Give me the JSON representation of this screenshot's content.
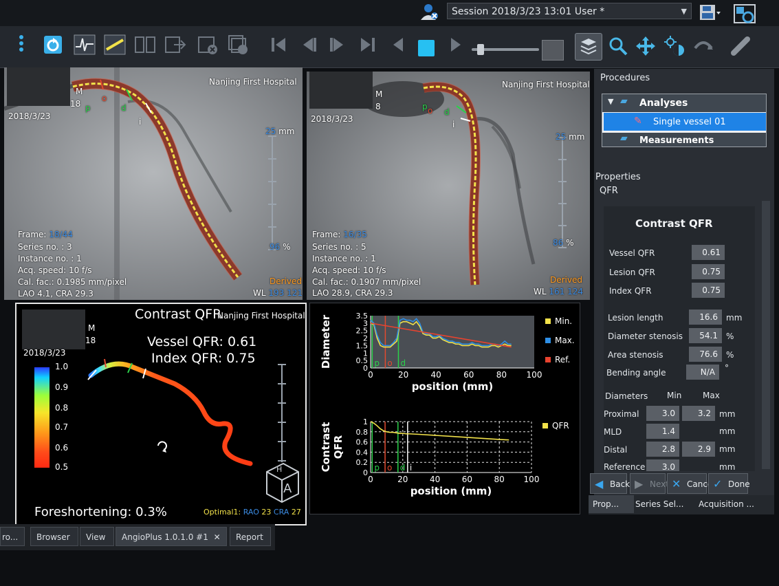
{
  "session": {
    "label": "Session 2018/3/23 13:01 User *"
  },
  "toolbar": {
    "items": [
      "menu-icon",
      "refresh-icon",
      "ecg-icon",
      "calibration-icon",
      "compare-icon",
      "export-icon",
      "delete-icon",
      "delete-all-icon",
      "first-frame-icon",
      "prev-frame-icon",
      "next-frame-icon",
      "last-frame-icon",
      "play-back-icon",
      "stop-icon",
      "play-icon",
      "zoom-icon",
      "pan-icon",
      "brightness-contrast-icon",
      "rotate-icon",
      "vessel-tool-icon"
    ]
  },
  "view1": {
    "hospital": "Nanjing First Hospital",
    "date": "2018/3/23",
    "name_fragment": "M",
    "id_fragment": "18",
    "frame_label": "Frame:",
    "frame_value": "18/44",
    "series": "Series no. : 3",
    "instance": "Instance no. : 1",
    "acq": "Acq. speed: 10 f/s",
    "cal": "Cal. fac.: 0.1985 mm/pixel",
    "angle": "LAO 4.1, CRA 29.3",
    "scale_mm": "25",
    "scale_unit": "mm",
    "zoom": "96",
    "zoom_unit": "%",
    "derived": "Derived",
    "wl_label": "WL",
    "wl_value": "193 121",
    "markers": {
      "p": "p",
      "o": "o",
      "d": "d",
      "i": "i"
    }
  },
  "view2": {
    "hospital": "Nanjing First Hospital",
    "date": "2018/3/23",
    "name_fragment": "M",
    "id_fragment": "8",
    "frame_label": "Frame:",
    "frame_value": "16/35",
    "series": "Series no. : 5",
    "instance": "Instance no. : 1",
    "acq": "Acq. speed: 10 f/s",
    "cal": "Cal. fac.: 0.1907 mm/pixel",
    "angle": "LAO 28.9, CRA 29.3",
    "scale_mm": "25",
    "scale_unit": "mm",
    "zoom": "86",
    "zoom_unit": "%",
    "derived": "Derived",
    "wl_label": "WL",
    "wl_value": "161 124",
    "markers": {
      "p": "p",
      "o": "o",
      "d": "d",
      "i": "i"
    }
  },
  "render3d": {
    "title": "Contrast QFR",
    "hospital": "Nanjing First Hospital",
    "name_fragment": "M",
    "id_fragment": "18",
    "date": "2018/3/23",
    "vessel_qfr": "Vessel QFR: 0.61",
    "index_qfr": "Index QFR: 0.75",
    "colorbar_ticks": [
      "1.0",
      "0.9",
      "0.8",
      "0.7",
      "0.6",
      "0.5"
    ],
    "foreshortening": "Foreshortening: 0.3%",
    "optimal_label": "Optimal1:",
    "optimal_rao_label": "RAO",
    "optimal_rao": "23",
    "optimal_cra_label": "CRA",
    "optimal_cra": "27",
    "cube_top": "H",
    "cube_front": "A"
  },
  "plots": {
    "diameter": {
      "ylabel": "Diameter",
      "xlabel": "position (mm)",
      "legend": [
        "Min.",
        "Max.",
        "Ref."
      ],
      "marker_labels": [
        "p",
        "o",
        "d"
      ]
    },
    "qfr": {
      "ylabel": "Contrast QFR",
      "xlabel": "position (mm)",
      "legend": [
        "QFR"
      ],
      "marker_labels": [
        "p",
        "o",
        "d",
        "i"
      ]
    }
  },
  "chart_data": [
    {
      "type": "line",
      "title": "",
      "xlabel": "position (mm)",
      "ylabel": "Diameter",
      "xlim": [
        0,
        100
      ],
      "ylim": [
        0,
        3.5
      ],
      "xticks": [
        "0",
        "20",
        "40",
        "60",
        "80",
        "100"
      ],
      "yticks": [
        "0",
        "0.5",
        "1",
        "1.5",
        "2",
        "2.5",
        "3",
        "3.5"
      ],
      "legend_position": "right",
      "markers": [
        {
          "label": "p",
          "x": 1
        },
        {
          "label": "o",
          "x": 9
        },
        {
          "label": "d",
          "x": 17
        }
      ],
      "series": [
        {
          "name": "Min.",
          "color": "#f2e24a",
          "x": [
            0,
            2,
            4,
            6,
            8,
            10,
            12,
            14,
            16,
            18,
            20,
            22,
            24,
            26,
            28,
            30,
            32,
            34,
            36,
            38,
            40,
            42,
            44,
            46,
            48,
            50,
            52,
            54,
            56,
            58,
            60,
            62,
            64,
            66,
            68,
            70,
            72,
            74,
            76,
            78,
            80,
            82,
            84,
            86
          ],
          "y": [
            3.0,
            2.9,
            2.0,
            1.5,
            1.4,
            1.4,
            1.4,
            1.6,
            1.8,
            3.0,
            3.1,
            3.1,
            3.0,
            2.9,
            3.1,
            2.8,
            2.3,
            2.2,
            2.2,
            2.0,
            2.0,
            2.1,
            1.9,
            1.8,
            1.7,
            1.7,
            1.6,
            1.6,
            1.5,
            1.5,
            1.5,
            1.6,
            1.5,
            1.5,
            1.4,
            1.4,
            1.4,
            1.5,
            1.5,
            1.4,
            1.5,
            1.6,
            1.5,
            1.5
          ]
        },
        {
          "name": "Max.",
          "color": "#2e8fe6",
          "x": [
            0,
            2,
            4,
            6,
            8,
            10,
            12,
            14,
            16,
            18,
            20,
            22,
            24,
            26,
            28,
            30,
            32,
            34,
            36,
            38,
            40,
            42,
            44,
            46,
            48,
            50,
            52,
            54,
            56,
            58,
            60,
            62,
            64,
            66,
            68,
            70,
            72,
            74,
            76,
            78,
            80,
            82,
            84,
            86
          ],
          "y": [
            3.2,
            3.0,
            2.2,
            1.7,
            1.5,
            1.5,
            1.5,
            1.7,
            2.0,
            3.2,
            3.3,
            3.2,
            3.2,
            3.1,
            3.3,
            3.0,
            2.4,
            2.3,
            2.3,
            2.1,
            2.1,
            2.2,
            2.0,
            1.9,
            1.8,
            1.8,
            1.7,
            1.7,
            1.6,
            1.6,
            1.6,
            1.7,
            1.6,
            1.6,
            1.5,
            1.5,
            1.5,
            1.6,
            1.6,
            1.5,
            1.6,
            1.8,
            1.6,
            1.6
          ]
        },
        {
          "name": "Ref.",
          "color": "#e8432f",
          "x": [
            0,
            86
          ],
          "y": [
            3.0,
            1.4
          ]
        }
      ]
    },
    {
      "type": "line",
      "title": "",
      "xlabel": "position (mm)",
      "ylabel": "Contrast QFR",
      "xlim": [
        0,
        100
      ],
      "ylim": [
        0,
        1
      ],
      "xticks": [
        "0",
        "20",
        "40",
        "60",
        "80",
        "100"
      ],
      "yticks": [
        "0",
        "0.2",
        "0.4",
        "0.6",
        "0.8",
        "1"
      ],
      "legend_position": "right",
      "grid": true,
      "markers": [
        {
          "label": "p",
          "x": 1
        },
        {
          "label": "o",
          "x": 9
        },
        {
          "label": "d",
          "x": 17
        },
        {
          "label": "i",
          "x": 23
        }
      ],
      "series": [
        {
          "name": "QFR",
          "color": "#f2e24a",
          "x": [
            0,
            2,
            4,
            6,
            8,
            10,
            12,
            14,
            16,
            18,
            20,
            22,
            24,
            30,
            40,
            50,
            60,
            70,
            80,
            86
          ],
          "y": [
            1.0,
            0.97,
            0.92,
            0.86,
            0.82,
            0.8,
            0.79,
            0.79,
            0.78,
            0.77,
            0.77,
            0.76,
            0.76,
            0.75,
            0.73,
            0.71,
            0.69,
            0.67,
            0.65,
            0.64
          ]
        }
      ]
    }
  ],
  "sidebar": {
    "procedures_title": "Procedures",
    "tree": {
      "analyses": "Analyses",
      "single_vessel": "Single vessel 01",
      "measurements": "Measurements"
    },
    "properties_title": "Properties",
    "properties_sub": "QFR",
    "panel_title": "Contrast QFR",
    "rows_top": [
      {
        "label": "Vessel QFR",
        "value": "0.61"
      },
      {
        "label": "Lesion QFR",
        "value": "0.75"
      },
      {
        "label": "Index QFR",
        "value": "0.75"
      }
    ],
    "rows_mid": [
      {
        "label": "Lesion length",
        "value": "16.6",
        "unit": "mm"
      },
      {
        "label": "Diameter stenosis",
        "value": "54.1",
        "unit": "%"
      },
      {
        "label": "Area stenosis",
        "value": "76.6",
        "unit": "%"
      },
      {
        "label": "Bending angle",
        "value": "N/A",
        "unit": "°"
      }
    ],
    "diameters_header": {
      "label": "Diameters",
      "min": "Min",
      "max": "Max"
    },
    "diameters": [
      {
        "label": "Proximal",
        "min": "3.0",
        "max": "3.2",
        "unit": "mm"
      },
      {
        "label": "MLD",
        "min": "1.4",
        "max": "",
        "unit": "mm"
      },
      {
        "label": "Distal",
        "min": "2.8",
        "max": "2.9",
        "unit": "mm"
      },
      {
        "label": "Reference",
        "min": "3.0",
        "max": "",
        "unit": "mm"
      }
    ],
    "buttons": {
      "back": "Back",
      "next": "Next",
      "cancel": "Cance",
      "done": "Done"
    },
    "tabs": [
      "Prop...",
      "Series Sel...",
      "Acquisition ..."
    ]
  },
  "bottom_tabs": [
    "ro...",
    "Browser",
    "View",
    "AngioPlus 1.0.1.0 #1",
    "Report"
  ]
}
